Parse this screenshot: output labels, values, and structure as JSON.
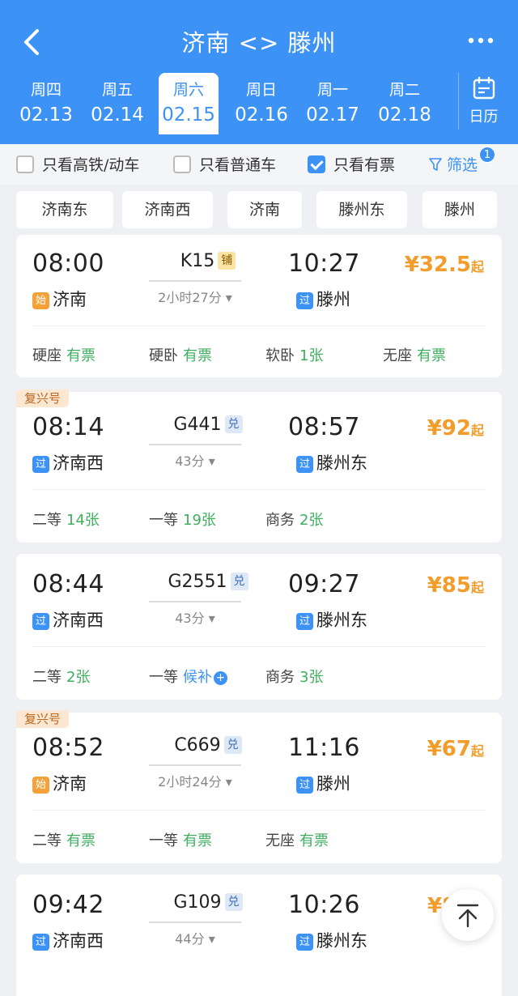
{
  "header": {
    "title": "济南 <> 滕州",
    "dates": [
      {
        "weekday": "周四",
        "date": "02.13"
      },
      {
        "weekday": "周五",
        "date": "02.14"
      },
      {
        "weekday": "周六",
        "date": "02.15"
      },
      {
        "weekday": "周日",
        "date": "02.16"
      },
      {
        "weekday": "周一",
        "date": "02.17"
      },
      {
        "weekday": "周二",
        "date": "02.18"
      }
    ],
    "calendar_label": "日历"
  },
  "filters": {
    "high_speed": "只看高铁/动车",
    "regular": "只看普通车",
    "available": "只看有票",
    "filter_label": "筛选",
    "filter_count": "1"
  },
  "stations": [
    "济南东",
    "济南西",
    "济南",
    "滕州东",
    "滕州"
  ],
  "colors": {
    "accent": "#3d92f5",
    "price": "#f29d2b",
    "available": "#3fae5f"
  },
  "trains": [
    {
      "badge": "",
      "dep_time": "08:00",
      "dep_tag": "始",
      "dep_station": "济南",
      "train_no": "K15",
      "train_tag": "铺",
      "duration": "2小时27分",
      "arr_time": "10:27",
      "arr_tag": "过",
      "arr_station": "滕州",
      "price": "¥32.5",
      "price_suffix": "起",
      "seats": [
        {
          "name": "硬座",
          "value": "有票"
        },
        {
          "name": "硬卧",
          "value": "有票"
        },
        {
          "name": "软卧",
          "value": "1张"
        },
        {
          "name": "无座",
          "value": "有票"
        }
      ]
    },
    {
      "badge": "复兴号",
      "dep_time": "08:14",
      "dep_tag": "过",
      "dep_station": "济南西",
      "train_no": "G441",
      "train_tag": "兑",
      "duration": "43分",
      "arr_time": "08:57",
      "arr_tag": "过",
      "arr_station": "滕州东",
      "price": "¥92",
      "price_suffix": "起",
      "seats": [
        {
          "name": "二等",
          "value": "14张"
        },
        {
          "name": "一等",
          "value": "19张"
        },
        {
          "name": "商务",
          "value": "2张"
        }
      ]
    },
    {
      "badge": "",
      "dep_time": "08:44",
      "dep_tag": "过",
      "dep_station": "济南西",
      "train_no": "G2551",
      "train_tag": "兑",
      "duration": "43分",
      "arr_time": "09:27",
      "arr_tag": "过",
      "arr_station": "滕州东",
      "price": "¥85",
      "price_suffix": "起",
      "seats": [
        {
          "name": "二等",
          "value": "2张"
        },
        {
          "name": "一等",
          "value": "候补"
        },
        {
          "name": "商务",
          "value": "3张"
        }
      ]
    },
    {
      "badge": "复兴号",
      "dep_time": "08:52",
      "dep_tag": "始",
      "dep_station": "济南",
      "train_no": "C669",
      "train_tag": "兑",
      "duration": "2小时24分",
      "arr_time": "11:16",
      "arr_tag": "过",
      "arr_station": "滕州",
      "price": "¥67",
      "price_suffix": "起",
      "seats": [
        {
          "name": "二等",
          "value": "有票"
        },
        {
          "name": "一等",
          "value": "有票"
        },
        {
          "name": "无座",
          "value": "有票"
        }
      ]
    },
    {
      "badge": "",
      "dep_time": "09:42",
      "dep_tag": "过",
      "dep_station": "济南西",
      "train_no": "G109",
      "train_tag": "兑",
      "duration": "44分",
      "arr_time": "10:26",
      "arr_tag": "过",
      "arr_station": "滕州东",
      "price": "¥8",
      "seats": []
    }
  ]
}
